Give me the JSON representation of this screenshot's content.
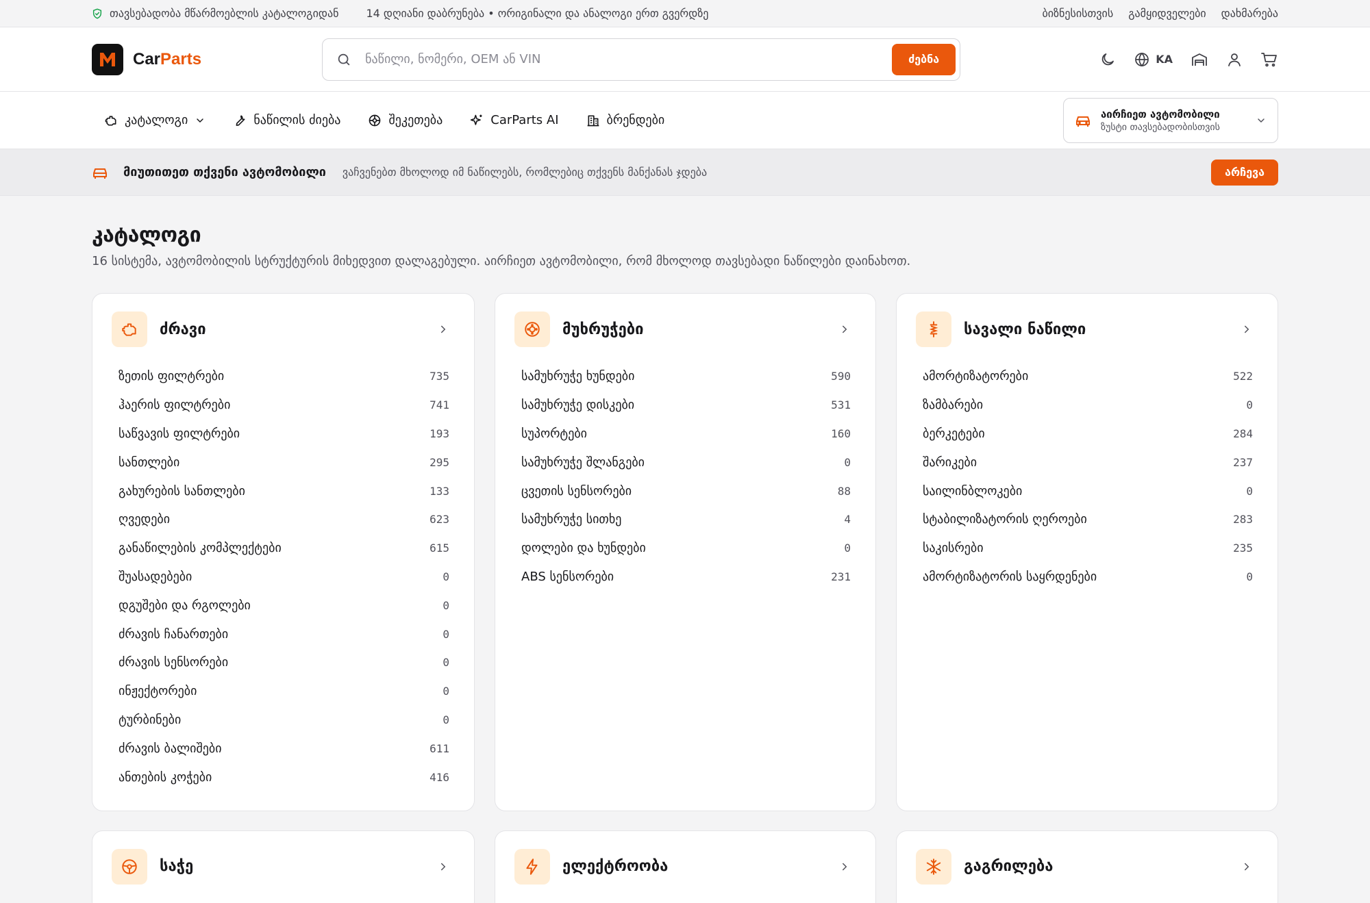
{
  "topbar": {
    "guarantee": "თავსებადობა მწარმოებლის კატალოგიდან",
    "returns": "14 დღიანი დაბრუნება • ორიგინალი და ანალოგი ერთ გვერდზე",
    "links": [
      "ბიზნესისთვის",
      "გამყიდველები",
      "დახმარება"
    ]
  },
  "header": {
    "logo_car": "Car",
    "logo_parts": "Parts",
    "search_placeholder": "ნაწილი, ნომერი, OEM ან VIN",
    "search_button": "ძებნა",
    "lang": "KA"
  },
  "nav": {
    "items": [
      "კატალოგი",
      "ნაწილის ძიება",
      "შეკეთება",
      "CarParts AI",
      "ბრენდები"
    ],
    "vehicle_title": "აირჩიეთ ავტომობილი",
    "vehicle_sub": "ზუსტი თავსებადობისთვის"
  },
  "vehicle_banner": {
    "title": "მიუთითეთ თქვენი ავტომობილი",
    "subtitle": "ვაჩვენებთ მხოლოდ იმ ნაწილებს, რომლებიც თქვენს მანქანას ჯდება",
    "button": "არჩევა"
  },
  "page": {
    "title": "კატალოგი",
    "subtitle": "16 სისტემა, ავტომობილის სტრუქტურის მიხედვით დალაგებული. აირჩიეთ ავტომობილი, რომ მხოლოდ თავსებადი ნაწილები დაინახოთ."
  },
  "accent_color": "#ea580c",
  "categories": [
    {
      "title": "ძრავი",
      "icon": "engine-icon",
      "items": [
        {
          "name": "ზეთის ფილტრები",
          "count": "735"
        },
        {
          "name": "ჰაერის ფილტრები",
          "count": "741"
        },
        {
          "name": "საწვავის ფილტრები",
          "count": "193"
        },
        {
          "name": "სანთლები",
          "count": "295"
        },
        {
          "name": "გახურების სანთლები",
          "count": "133"
        },
        {
          "name": "ღვედები",
          "count": "623"
        },
        {
          "name": "განაწილების კომპლექტები",
          "count": "615"
        },
        {
          "name": "შუასადებები",
          "count": "0"
        },
        {
          "name": "დგუშები და რგოლები",
          "count": "0"
        },
        {
          "name": "ძრავის ჩანართები",
          "count": "0"
        },
        {
          "name": "ძრავის სენსორები",
          "count": "0"
        },
        {
          "name": "ინჟექტორები",
          "count": "0"
        },
        {
          "name": "ტურბინები",
          "count": "0"
        },
        {
          "name": "ძრავის ბალიშები",
          "count": "611"
        },
        {
          "name": "ანთების კოჭები",
          "count": "416"
        }
      ]
    },
    {
      "title": "მუხრუჭები",
      "icon": "brake-disc-icon",
      "items": [
        {
          "name": "სამუხრუჭე ხუნდები",
          "count": "590"
        },
        {
          "name": "სამუხრუჭე დისკები",
          "count": "531"
        },
        {
          "name": "სუპორტები",
          "count": "160"
        },
        {
          "name": "სამუხრუჭე შლანგები",
          "count": "0"
        },
        {
          "name": "ცვეთის სენსორები",
          "count": "88"
        },
        {
          "name": "სამუხრუჭე სითხე",
          "count": "4"
        },
        {
          "name": "დოლები და ხუნდები",
          "count": "0"
        },
        {
          "name": "ABS სენსორები",
          "count": "231"
        }
      ]
    },
    {
      "title": "სავალი ნაწილი",
      "icon": "suspension-icon",
      "items": [
        {
          "name": "ამორტიზატორები",
          "count": "522"
        },
        {
          "name": "ზამბარები",
          "count": "0"
        },
        {
          "name": "ბერკეტები",
          "count": "284"
        },
        {
          "name": "შარიკები",
          "count": "237"
        },
        {
          "name": "საილინბლოკები",
          "count": "0"
        },
        {
          "name": "სტაბილიზატორის ღეროები",
          "count": "283"
        },
        {
          "name": "საკისრები",
          "count": "235"
        },
        {
          "name": "ამორტიზატორის საყრდენები",
          "count": "0"
        }
      ]
    }
  ],
  "categories_row2": [
    {
      "title": "საჭე",
      "icon": "steering-wheel-icon"
    },
    {
      "title": "ელექტროობა",
      "icon": "lightning-icon"
    },
    {
      "title": "გაგრილება",
      "icon": "snowflake-icon"
    }
  ]
}
